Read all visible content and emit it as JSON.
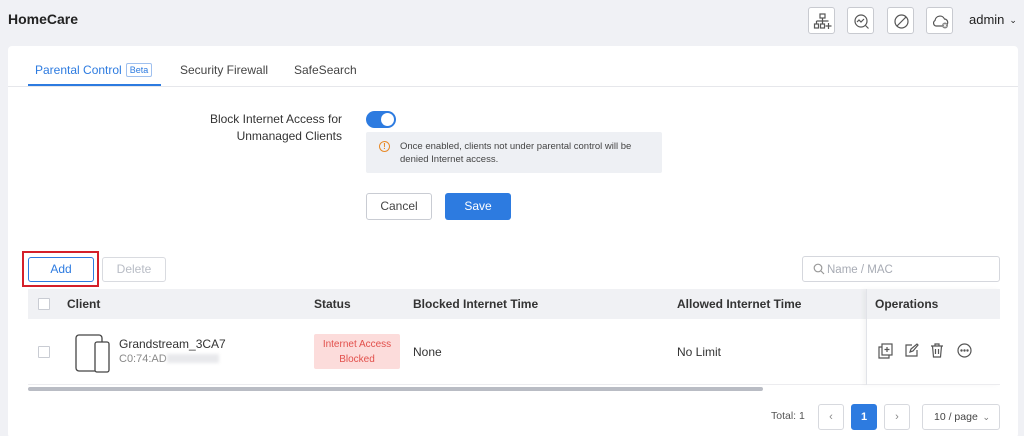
{
  "app": {
    "title": "HomeCare"
  },
  "header": {
    "icons": [
      "network-topology-icon",
      "diagnostics-icon",
      "block-icon",
      "cloud-icon"
    ],
    "user": "admin"
  },
  "tabs": [
    {
      "label": "Parental Control",
      "badge": "Beta",
      "active": true
    },
    {
      "label": "Security Firewall",
      "active": false
    },
    {
      "label": "SafeSearch",
      "active": false
    }
  ],
  "setting": {
    "label": "Block Internet Access for Unmanaged Clients",
    "enabled": true,
    "info": "Once enabled, clients not under parental control will be denied Internet access.",
    "cancel_label": "Cancel",
    "save_label": "Save"
  },
  "toolbar": {
    "add_label": "Add",
    "delete_label": "Delete",
    "search_placeholder": "Name / MAC"
  },
  "table": {
    "columns": [
      "Client",
      "Status",
      "Blocked Internet Time",
      "Allowed Internet Time",
      "Operations"
    ],
    "rows": [
      {
        "client_name": "Grandstream_3CA7",
        "mac": "C0:74:AD",
        "status": "Internet Access Blocked",
        "blocked_time": "None",
        "allowed_time": "No Limit"
      }
    ]
  },
  "pagination": {
    "total_label": "Total: 1",
    "current_page": "1",
    "page_size": "10 / page"
  },
  "colors": {
    "accent": "#2d7be0",
    "status_blocked_bg": "#fcdcdb",
    "status_blocked_text": "#e2504c",
    "highlight": "#d4202a"
  }
}
